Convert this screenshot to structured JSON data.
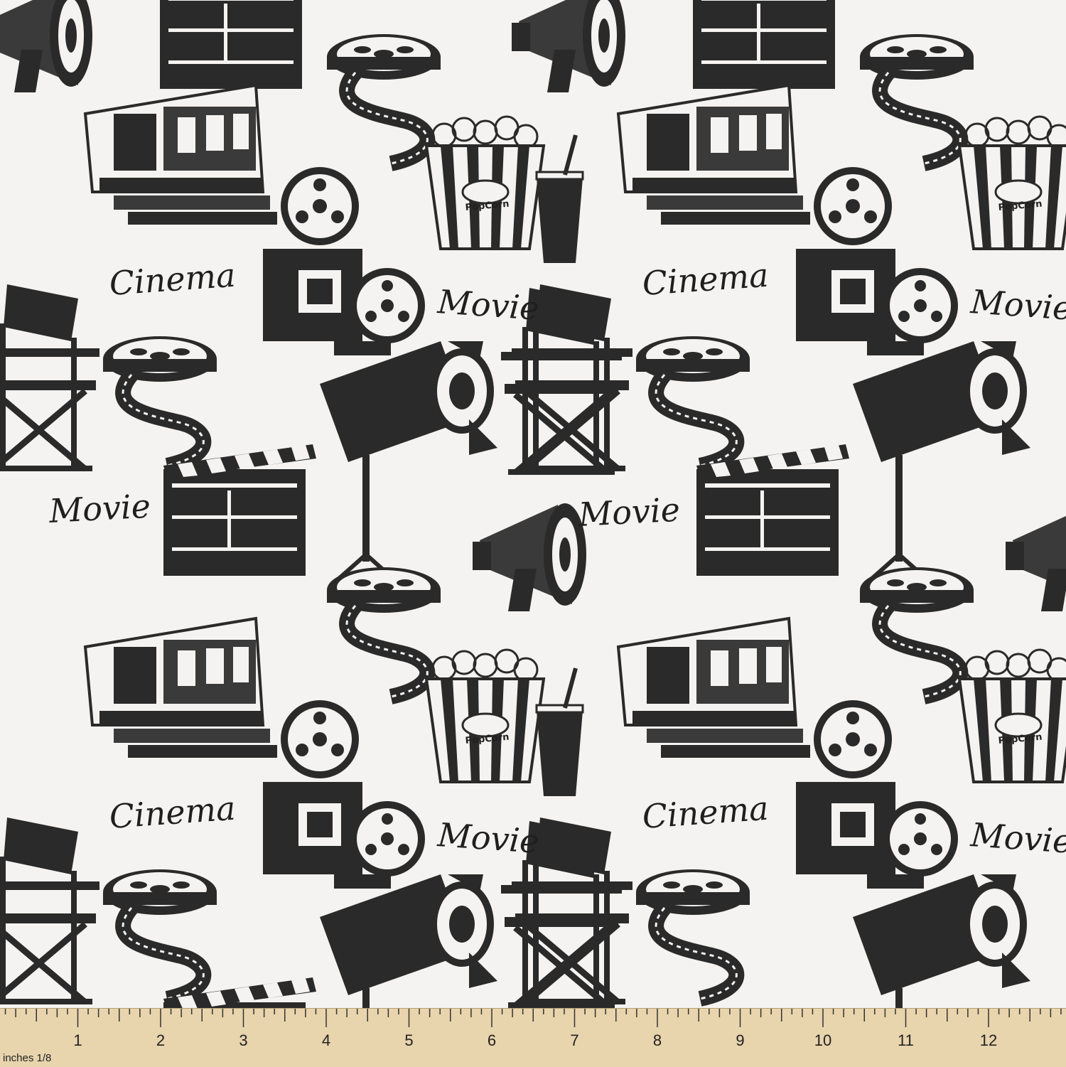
{
  "pattern": {
    "words": [
      "Cinema",
      "Movie"
    ],
    "popcorn_label": "PopCorn",
    "ink": "#1f1f1f",
    "paper": "#f4f3f1"
  },
  "ruler": {
    "unit_label": "inches 1/8",
    "numbers": [
      "1",
      "2",
      "3",
      "4",
      "5",
      "6",
      "7",
      "8",
      "9",
      "10",
      "11",
      "12",
      "1"
    ],
    "color": "#e8d4ad"
  }
}
